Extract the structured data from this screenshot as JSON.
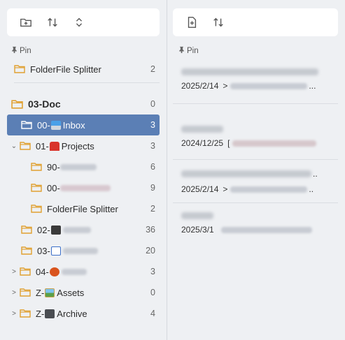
{
  "left": {
    "pin_label": "Pin",
    "pinned": [
      {
        "label": "FolderFile Splitter",
        "count": "2"
      }
    ],
    "root": {
      "label": "03-Doc",
      "count": "0"
    },
    "folders": [
      {
        "prefix": "00-",
        "emoji": "inbox",
        "label": "Inbox",
        "count": "3"
      },
      {
        "prefix": "01-",
        "emoji": "projects",
        "label": "Projects",
        "count": "3"
      },
      {
        "prefix": "90-",
        "label": "",
        "count": "6"
      },
      {
        "prefix": "00-",
        "label": "",
        "count": "9"
      },
      {
        "label": "FolderFile Splitter",
        "count": "2"
      },
      {
        "prefix": "02-",
        "label": "",
        "count": "36"
      },
      {
        "prefix": "03-",
        "label": "",
        "count": "20"
      },
      {
        "prefix": "04-",
        "label": "",
        "count": "3"
      },
      {
        "prefix": "Z-",
        "emoji": "assets",
        "label": "Assets",
        "count": "0"
      },
      {
        "prefix": "Z-",
        "emoji": "archive",
        "label": "Archive",
        "count": "4"
      }
    ],
    "chevrons": {
      "expanded": "⌄",
      "collapsed": ">"
    }
  },
  "right": {
    "pin_label": "Pin",
    "notes": [
      {
        "date": "2025/2/14",
        "sep": ">",
        "tail": "..."
      },
      {
        "date": "2024/12/25",
        "sep": "[",
        "tail": ""
      },
      {
        "date": "2025/2/14",
        "sep": ">",
        "tail": "..",
        "title_tail": ".."
      },
      {
        "date": "2025/3/1",
        "sep": "",
        "tail": ""
      }
    ]
  },
  "colors": {
    "selected": "#5b7fb5",
    "folder": "#e0a030"
  },
  "icons": [
    "new-folder-icon",
    "sort-icon",
    "expand-collapse-icon",
    "new-file-icon",
    "pin-icon",
    "folder-icon"
  ]
}
